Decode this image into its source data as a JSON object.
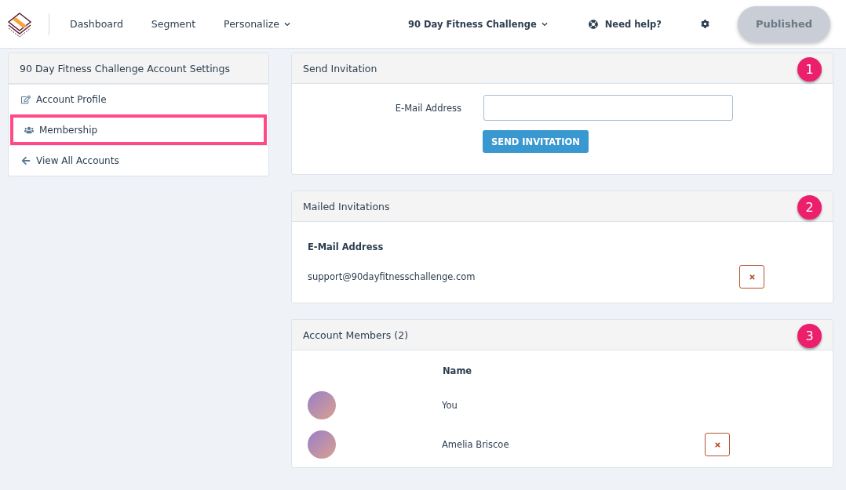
{
  "nav": {
    "items": [
      {
        "label": "Dashboard",
        "dropdown": false
      },
      {
        "label": "Segment",
        "dropdown": false
      },
      {
        "label": "Personalize",
        "dropdown": true
      }
    ],
    "account": "90 Day Fitness Challenge",
    "help": "Need help?",
    "publish": "Published"
  },
  "sidebar": {
    "title": "90 Day Fitness Challenge Account Settings",
    "items": [
      {
        "label": "Account Profile",
        "kind": "edit",
        "selected": false
      },
      {
        "label": "Membership",
        "kind": "users",
        "selected": true
      },
      {
        "label": "View All Accounts",
        "kind": "back",
        "selected": false
      }
    ]
  },
  "send_invitation": {
    "title": "Send Invitation",
    "step": "1",
    "field_label": "E-Mail Address",
    "button": "SEND INVITATION"
  },
  "mailed_invitations": {
    "title": "Mailed Invitations",
    "step": "2",
    "column": "E-Mail Address",
    "rows": [
      {
        "email": "support@90dayfitnesschallenge.com",
        "removable": true
      }
    ]
  },
  "account_members": {
    "title": "Account Members (2)",
    "step": "3",
    "column": "Name",
    "rows": [
      {
        "name": "You",
        "removable": false
      },
      {
        "name": "Amelia Briscoe",
        "removable": true
      }
    ]
  }
}
